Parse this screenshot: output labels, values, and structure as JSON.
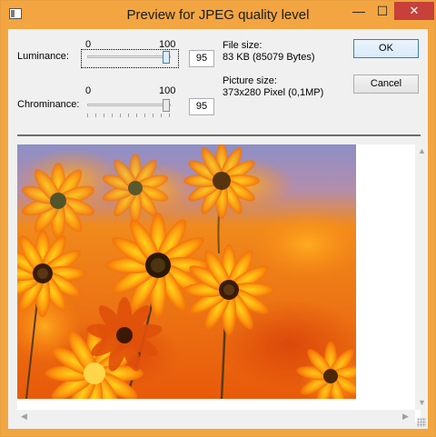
{
  "window": {
    "title": "Preview for JPEG quality level"
  },
  "titlebar": {
    "minimize_glyph": "—",
    "maximize_glyph": "☐",
    "close_glyph": "✕"
  },
  "luminance": {
    "label": "Luminance:",
    "min_label": "0",
    "max_label": "100",
    "value": 95,
    "value_text": "95"
  },
  "chrominance": {
    "label": "Chrominance:",
    "min_label": "0",
    "max_label": "100",
    "value": 95,
    "value_text": "95"
  },
  "file_info": {
    "size_label": "File size:",
    "size_value": "83 KB (85079 Bytes)",
    "picture_label": "Picture size:",
    "picture_value": "373x280 Pixel (0,1MP)"
  },
  "buttons": {
    "ok": "OK",
    "cancel": "Cancel"
  },
  "colors": {
    "title_bar": "#f2a540",
    "close_button": "#c7403a",
    "accent": "#3c7fb1"
  },
  "icons": {
    "app": "app-window-icon",
    "scroll_up": "chevron-up-icon",
    "scroll_down": "chevron-down-icon",
    "scroll_left": "chevron-left-icon",
    "scroll_right": "chevron-right-icon"
  }
}
